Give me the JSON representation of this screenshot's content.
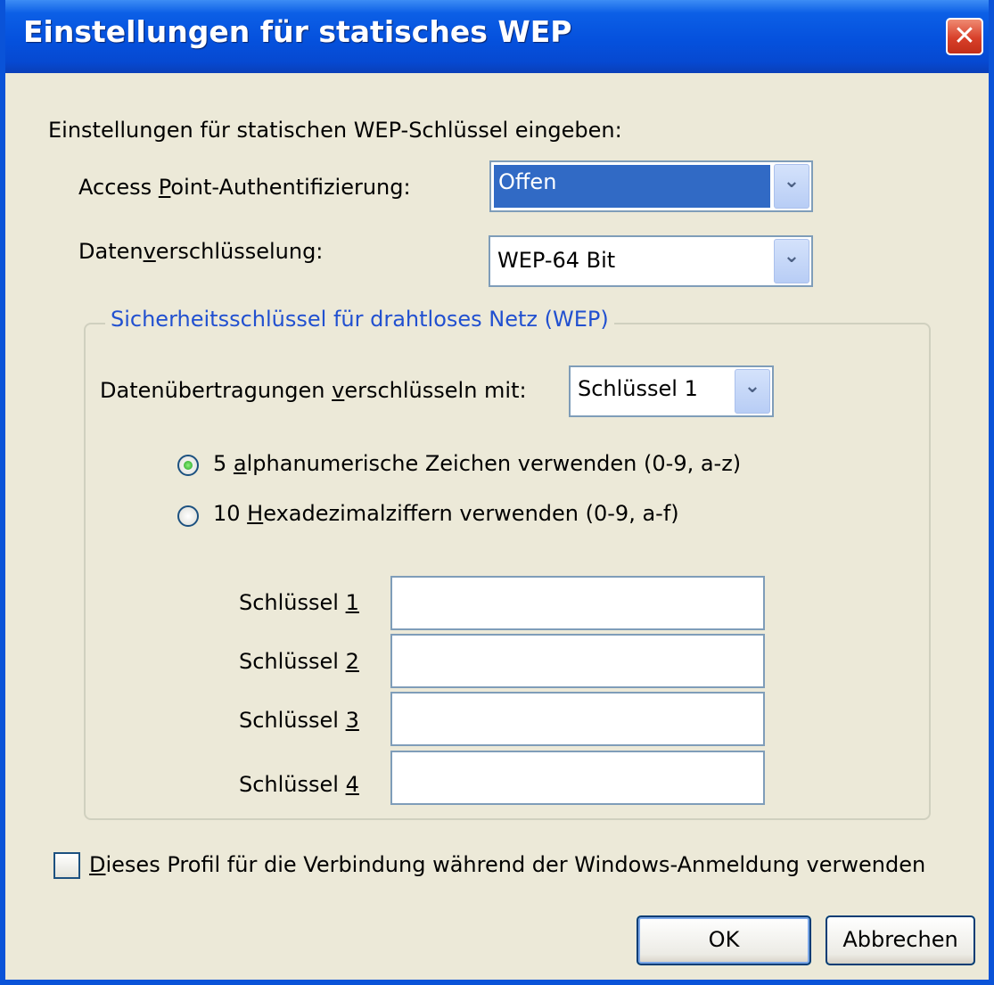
{
  "window": {
    "title": "Einstellungen für statisches WEP",
    "close_glyph": "✕"
  },
  "intro_label": "Einstellungen für statischen WEP-Schlüssel eingeben:",
  "auth": {
    "label_pre": "Access ",
    "label_key": "P",
    "label_post": "oint-Authentifizierung:",
    "value": "Offen",
    "arrow": "⌄"
  },
  "encryption": {
    "label_pre": "Daten",
    "label_key": "v",
    "label_post": "erschlüsselung:",
    "value": "WEP-64 Bit",
    "arrow": "⌄"
  },
  "group": {
    "legend": "Sicherheitsschlüssel für drahtloses Netz (WEP)",
    "encrypt_with": {
      "label_pre": "Datenübertragungen ",
      "label_key": "v",
      "label_post": "erschlüsseln mit:",
      "value": "Schlüssel 1",
      "arrow": "⌄"
    },
    "radio_alnum": {
      "label_pre": "5 ",
      "label_key": "a",
      "label_post": "lphanumerische Zeichen verwenden (0-9, a-z)",
      "checked": true
    },
    "radio_hex": {
      "label_pre": "10 ",
      "label_key": "H",
      "label_post": "exadezimalziffern verwenden (0-9, a-f)",
      "checked": false
    },
    "keys": [
      {
        "label": "Schlüssel ",
        "num": "1",
        "value": ""
      },
      {
        "label": "Schlüssel ",
        "num": "2",
        "value": ""
      },
      {
        "label": "Schlüssel ",
        "num": "3",
        "value": ""
      },
      {
        "label": "Schlüssel ",
        "num": "4",
        "value": ""
      }
    ]
  },
  "profile_checkbox": {
    "label_key": "D",
    "label_post": "ieses Profil für die Verbindung während der Windows-Anmeldung verwenden",
    "checked": false
  },
  "buttons": {
    "ok": "OK",
    "cancel": "Abbrechen"
  }
}
